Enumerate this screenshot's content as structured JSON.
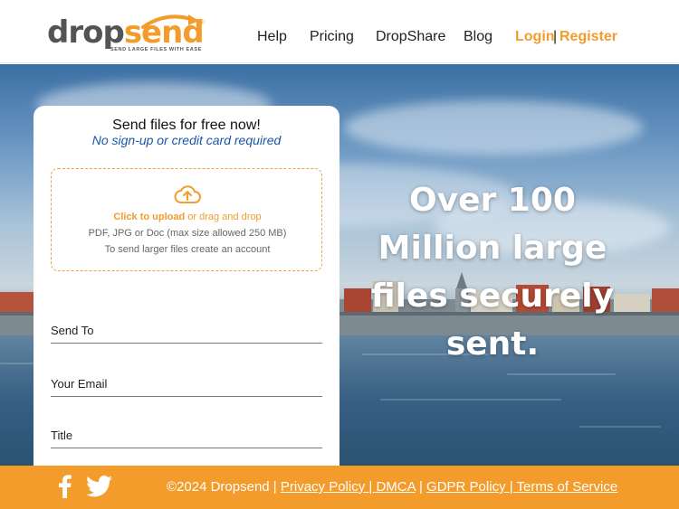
{
  "header": {
    "logo": {
      "text_a": "drop",
      "text_b": "send",
      "registered": "®",
      "tagline": "SEND LARGE FILES WITH EASE"
    },
    "nav": {
      "help": "Help",
      "pricing": "Pricing",
      "dropshare": "DropShare",
      "blog": "Blog",
      "login": "Login",
      "separator": "|",
      "register": "Register"
    }
  },
  "hero": {
    "headline": [
      "Over 100",
      "Million large",
      "files securely",
      "sent."
    ]
  },
  "card": {
    "title": "Send files for free now!",
    "subtitle": "No sign-up or credit card required",
    "upload": {
      "click_text": "Click to upload",
      "drag_text": " or drag and drop",
      "formats": "PDF, JPG or Doc (max size allowed 250 MB)",
      "larger_note": "To send larger files create an account",
      "icon": "cloud-upload-icon"
    },
    "fields": {
      "send_to": "Send To",
      "your_email": "Your Email",
      "title": "Title"
    }
  },
  "footer": {
    "copyright": "©2024 Dropsend | ",
    "privacy": "Privacy Policy ",
    "sep1": "| ",
    "dmca": "DMCA",
    "sep2": " | ",
    "gdpr": "GDPR Policy ",
    "sep3": "| ",
    "terms": "Terms of Service",
    "social": [
      "facebook-icon",
      "twitter-icon"
    ]
  },
  "colors": {
    "accent": "#f39c2c",
    "subtitle_blue": "#1a56a8",
    "footer_bg": "#f39c2c"
  }
}
